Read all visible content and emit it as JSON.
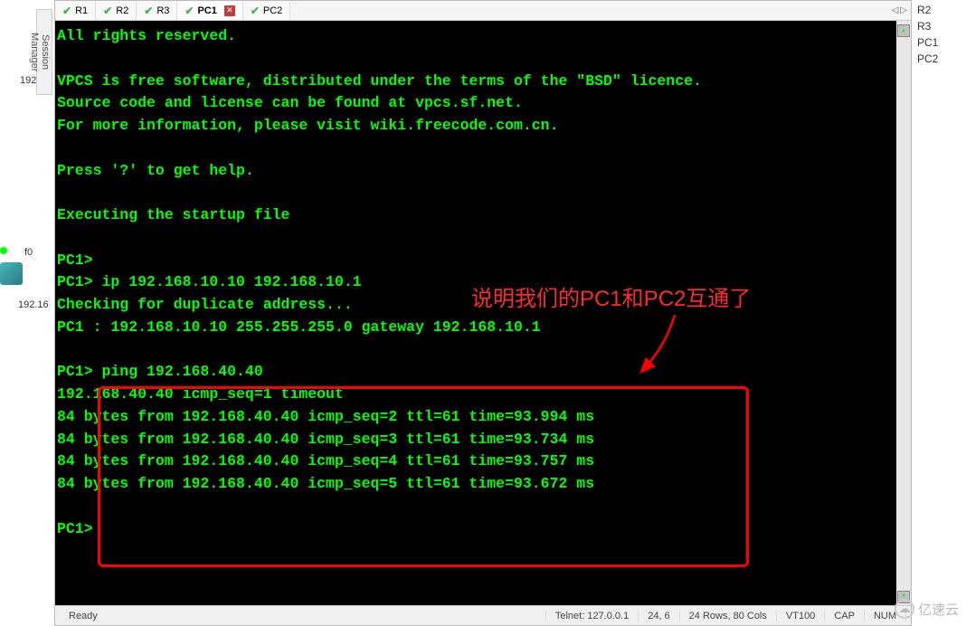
{
  "session_manager_label": "Session Manager",
  "left_labels": {
    "top": "192",
    "f0": "f0",
    "ip": "192.16"
  },
  "tabs": [
    {
      "label": "R1",
      "active": false,
      "closeable": false
    },
    {
      "label": "R2",
      "active": false,
      "closeable": false
    },
    {
      "label": "R3",
      "active": false,
      "closeable": false
    },
    {
      "label": "PC1",
      "active": true,
      "closeable": true
    },
    {
      "label": "PC2",
      "active": false,
      "closeable": false
    }
  ],
  "terminal_lines": [
    "All rights reserved.",
    "",
    "VPCS is free software, distributed under the terms of the \"BSD\" licence.",
    "Source code and license can be found at vpcs.sf.net.",
    "For more information, please visit wiki.freecode.com.cn.",
    "",
    "Press '?' to get help.",
    "",
    "Executing the startup file",
    "",
    "PC1>",
    "PC1> ip 192.168.10.10 192.168.10.1",
    "Checking for duplicate address...",
    "PC1 : 192.168.10.10 255.255.255.0 gateway 192.168.10.1",
    "",
    "PC1> ping 192.168.40.40",
    "192.168.40.40 icmp_seq=1 timeout",
    "84 bytes from 192.168.40.40 icmp_seq=2 ttl=61 time=93.994 ms",
    "84 bytes from 192.168.40.40 icmp_seq=3 ttl=61 time=93.734 ms",
    "84 bytes from 192.168.40.40 icmp_seq=4 ttl=61 time=93.757 ms",
    "84 bytes from 192.168.40.40 icmp_seq=5 ttl=61 time=93.672 ms",
    "",
    "PC1>"
  ],
  "annotation_text": "说明我们的PC1和PC2互通了",
  "status_bar": {
    "ready": "Ready",
    "connection": "Telnet: 127.0.0.1",
    "cursor": "24,  6",
    "size": "24 Rows, 80 Cols",
    "term": "VT100",
    "cap": "CAP",
    "num": "NUM"
  },
  "right_panel_items": [
    "R2",
    "R3",
    "PC1",
    "PC2"
  ],
  "watermark": "亿速云"
}
